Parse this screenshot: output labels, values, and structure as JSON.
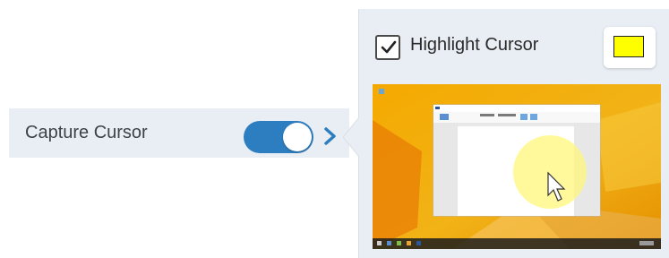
{
  "capture": {
    "label": "Capture Cursor",
    "toggle_state": "on",
    "toggle_color": "#2d7ec0"
  },
  "chevron_icon": "chevron-right-icon",
  "popover": {
    "highlight_checked": true,
    "highlight_label": "Highlight Cursor",
    "highlight_color": "#ffff00",
    "preview_icon": "cursor-highlight-preview"
  }
}
